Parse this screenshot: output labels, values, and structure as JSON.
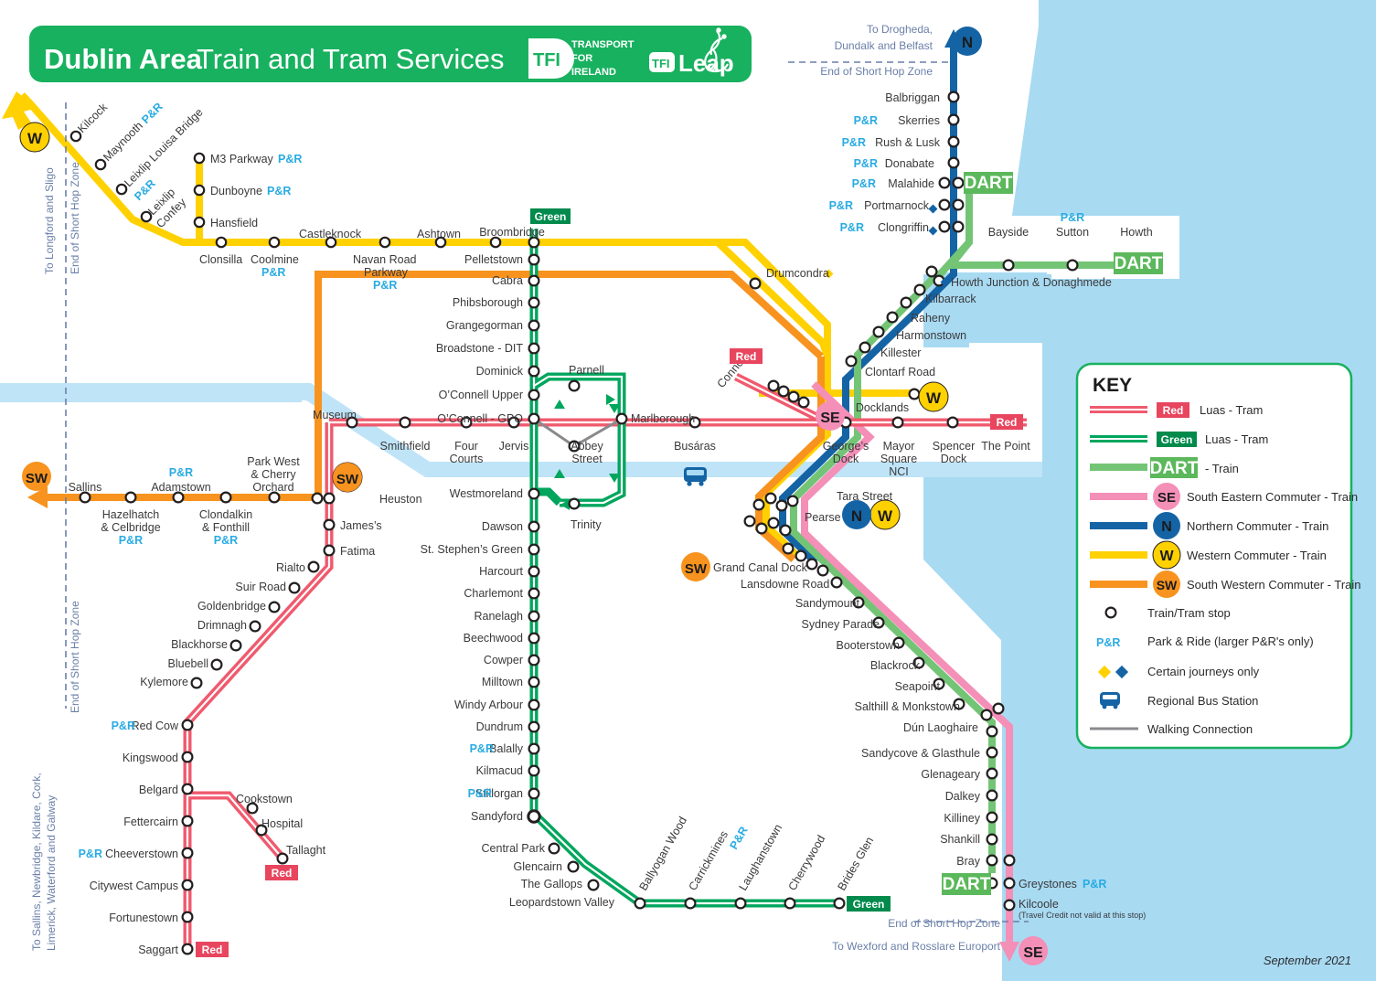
{
  "header": {
    "title_bold": "Dublin Area",
    "title_regular": " Train and Tram Services",
    "logo_tfi": "TFI",
    "logo_tfi_lines": [
      "TRANSPORT",
      "FOR",
      "IRELAND"
    ],
    "logo_leap_tfi": "TFI",
    "logo_leap": "Leap",
    "bg_color": "#18b15f"
  },
  "footer": {
    "date": "September 2021"
  },
  "colors": {
    "red_luas": "#f05a6e",
    "green_luas": "#00a65d",
    "dart": "#74c476",
    "south_eastern": "#f48fb7",
    "northern": "#1464a5",
    "western": "#ffd100",
    "south_western": "#f7931e",
    "water": "#a8daf2",
    "pr_blue": "#29abe2",
    "zone_blue": "#6a7fa8",
    "label": "#3a3a3c"
  },
  "key": {
    "title": "KEY",
    "rows": [
      {
        "badge": "Red",
        "badge_style": "red-pill",
        "label": "Luas - Tram",
        "line_color": "#f05a6e",
        "line_style": "tram"
      },
      {
        "badge": "Green",
        "badge_style": "green-pill",
        "label": "Luas - Tram",
        "line_color": "#00a65d",
        "line_style": "tram"
      },
      {
        "badge": "DART",
        "badge_style": "dart-pill",
        "label": "- Train",
        "line_color": "#74c476",
        "line_style": "solid"
      },
      {
        "badge": "SE",
        "badge_style": "circle-se",
        "label": "South Eastern Commuter - Train",
        "line_color": "#f48fb7",
        "line_style": "solid"
      },
      {
        "badge": "N",
        "badge_style": "circle-n",
        "label": "Northern Commuter - Train",
        "line_color": "#1464a5",
        "line_style": "solid"
      },
      {
        "badge": "W",
        "badge_style": "circle-w",
        "label": "Western Commuter - Train",
        "line_color": "#ffd100",
        "line_style": "solid"
      },
      {
        "badge": "SW",
        "badge_style": "circle-sw",
        "label": "South Western Commuter - Train",
        "line_color": "#f7931e",
        "line_style": "solid"
      }
    ],
    "symbols": [
      {
        "icon": "stop-circle-icon",
        "label": "Train/Tram stop"
      },
      {
        "icon": "park-and-ride-icon",
        "label": "Park & Ride (larger P&R's only)",
        "text": "P&R"
      },
      {
        "icon": "diamond-icon",
        "label": "Certain journeys only"
      },
      {
        "icon": "bus-station-icon",
        "label": "Regional Bus Station"
      },
      {
        "icon": "walking-line-icon",
        "label": "Walking Connection"
      }
    ]
  },
  "zone_notes": {
    "north_dest": "To Drogheda,\nDundalk and Belfast",
    "north_dest_l1": "To Drogheda,",
    "north_dest_l2": "Dundalk and Belfast",
    "north_zone": "End of Short Hop Zone",
    "northwest_dest": "To Longford and Sligo",
    "northwest_zone": "End of Short Hop Zone",
    "southwest_dest": "To Sallins, Newbridge, Kildare, Cork,",
    "southwest_dest2": "Limerick, Waterford and Galway",
    "southwest_zone": "End of Short Hop Zone",
    "southeast_zone": "End of Short Hop Zone",
    "southeast_dest": "To Wexford and Rosslare Europort",
    "kilcoole_note": "(Travel Credit not valid at this stop)"
  },
  "lines": {
    "western": {
      "name": "Western Commuter",
      "badge": "W",
      "stops_maynooth": [
        "Kilcock",
        "Maynooth",
        "Leixlip Louisa Bridge",
        "Leixlip Confey",
        "Clonsilla",
        "Coolmine",
        "Castleknock",
        "Navan Road Parkway",
        "Ashtown",
        "Broombridge",
        "Pelletstown"
      ],
      "stops_m3": [
        "M3 Parkway",
        "Dunboyne",
        "Hansfield"
      ],
      "stops_docklands": [
        "Docklands"
      ],
      "pr_stops": [
        "Maynooth",
        "Leixlip Louisa Bridge",
        "Coolmine",
        "Navan Road Parkway",
        "M3 Parkway",
        "Dunboyne"
      ]
    },
    "northern": {
      "name": "Northern Commuter",
      "badge": "N",
      "stops": [
        "Balbriggan",
        "Skerries",
        "Rush & Lusk",
        "Donabate",
        "Malahide",
        "Portmarnock",
        "Clongriffin",
        "Howth Junction & Donaghmede",
        "Kilbarrack",
        "Raheny",
        "Harmonstown",
        "Killester",
        "Clontarf Road",
        "Connolly",
        "Tara Street",
        "Pearse",
        "Drumcondra"
      ],
      "pr_stops": [
        "Skerries",
        "Rush & Lusk",
        "Donabate",
        "Malahide",
        "Portmarnock",
        "Clongriffin"
      ],
      "certain_journeys": [
        "Portmarnock",
        "Clongriffin",
        "Drumcondra",
        "Howth Junction & Donaghmede"
      ]
    },
    "dart": {
      "name": "DART",
      "badge": "DART",
      "stops_north": [
        "Malahide",
        "Portmarnock",
        "Clongriffin",
        "Howth Junction & Donaghmede",
        "Kilbarrack",
        "Raheny",
        "Harmonstown",
        "Killester",
        "Clontarf Road",
        "Connolly"
      ],
      "stops_howth_branch": [
        "Bayside",
        "Sutton",
        "Howth"
      ],
      "stops_south": [
        "Tara Street",
        "Pearse",
        "Grand Canal Dock",
        "Lansdowne Road",
        "Sandymount",
        "Sydney Parade",
        "Booterstown",
        "Blackrock",
        "Seapoint",
        "Salthill & Monkstown",
        "Dún Laoghaire",
        "Sandycove & Glasthule",
        "Glenageary",
        "Dalkey",
        "Killiney",
        "Shankill",
        "Bray",
        "Greystones"
      ],
      "pr_stops": [
        "Sutton",
        "Greystones"
      ]
    },
    "south_eastern": {
      "name": "South Eastern Commuter",
      "badge": "SE",
      "stops": [
        "Connolly",
        "Tara Street",
        "Pearse",
        "Grand Canal Dock",
        "Lansdowne Road",
        "Sandymount",
        "Sydney Parade",
        "Booterstown",
        "Blackrock",
        "Seapoint",
        "Salthill & Monkstown",
        "Dún Laoghaire",
        "Sandycove & Glasthule",
        "Glenageary",
        "Dalkey",
        "Killiney",
        "Shankill",
        "Bray",
        "Greystones",
        "Kilcoole"
      ]
    },
    "south_western": {
      "name": "South Western Commuter",
      "badge": "SW",
      "stops": [
        "Sallins",
        "Hazelhatch & Celbridge",
        "Adamstown",
        "Clondalkin & Fonthill",
        "Park West & Cherry Orchard",
        "Heuston",
        "Grand Canal Dock"
      ],
      "pr_stops": [
        "Hazelhatch & Celbridge",
        "Adamstown",
        "Clondalkin & Fonthill"
      ]
    },
    "red_luas": {
      "name": "Red Luas",
      "badge": "Red",
      "stops_main": [
        "Museum",
        "Smithfield",
        "Four Courts",
        "Jervis",
        "Abbey Street",
        "Busáras",
        "George's Dock",
        "Mayor Square NCI",
        "Spencer Dock",
        "The Point"
      ],
      "stops_west": [
        "Heuston",
        "James's",
        "Fatima",
        "Rialto",
        "Suir Road",
        "Goldenbridge",
        "Drimnagh",
        "Blackhorse",
        "Bluebell",
        "Kylemore",
        "Red Cow",
        "Kingswood",
        "Belgard",
        "Fettercairn",
        "Cheeverstown",
        "Citywest Campus",
        "Fortunestown",
        "Saggart"
      ],
      "stops_tallaght_branch": [
        "Cookstown",
        "Hospital",
        "Tallaght"
      ],
      "pr_stops": [
        "Red Cow",
        "Cheeverstown"
      ],
      "termini": [
        "Saggart",
        "Tallaght",
        "The Point"
      ]
    },
    "green_luas": {
      "name": "Green Luas",
      "badge": "Green",
      "stops": [
        "Broombridge",
        "Cabra",
        "Phibsborough",
        "Grangegorman",
        "Broadstone - DIT",
        "Dominick",
        "Parnell",
        "O'Connell Upper",
        "O'Connell - GPO",
        "Marlborough",
        "Abbey Street",
        "Westmoreland",
        "Trinity",
        "Dawson",
        "St. Stephen's Green",
        "Harcourt",
        "Charlemont",
        "Ranelagh",
        "Beechwood",
        "Cowper",
        "Milltown",
        "Windy Arbour",
        "Dundrum",
        "Balally",
        "Kilmacud",
        "Stillorgan",
        "Sandyford",
        "Central Park",
        "Glencairn",
        "The Gallops",
        "Leopardstown Valley",
        "Ballyogan Wood",
        "Carrickmines",
        "Laughanstown",
        "Cherrywood",
        "Brides Glen"
      ],
      "pr_stops": [
        "Balally",
        "Stillorgan",
        "Carrickmines"
      ],
      "termini": [
        "Broombridge",
        "Brides Glen"
      ]
    }
  },
  "labels": {
    "kilcock": "Kilcock",
    "maynooth": "Maynooth",
    "leixlip_louisa": "Leixlip Louisa Bridge",
    "leixlip_confey": "Leixlip Confey",
    "m3_parkway": "M3 Parkway",
    "dunboyne": "Dunboyne",
    "hansfield": "Hansfield",
    "clonsilla": "Clonsilla",
    "coolmine": "Coolmine",
    "castleknock": "Castleknock",
    "navan_road": "Navan Road",
    "parkway": "Parkway",
    "ashtown": "Ashtown",
    "broombridge": "Broombridge",
    "pelletstown": "Pelletstown",
    "cabra": "Cabra",
    "phibsborough": "Phibsborough",
    "grangegorman": "Grangegorman",
    "broadstone": "Broadstone - DIT",
    "dominick": "Dominick",
    "parnell": "Parnell",
    "oconnell_upper": "O’Connell Upper",
    "oconnell_gpo": "O’Connell - GPO",
    "marlborough": "Marlborough",
    "museum": "Museum",
    "smithfield": "Smithfield",
    "four_courts_1": "Four",
    "four_courts_2": "Courts",
    "jervis": "Jervis",
    "abbey_1": "Abbey",
    "abbey_2": "Street",
    "busaras": "Busáras",
    "westmoreland": "Westmoreland",
    "trinity": "Trinity",
    "dawson": "Dawson",
    "stephens_green": "St. Stephen’s Green",
    "harcourt": "Harcourt",
    "charlemont": "Charlemont",
    "ranelagh": "Ranelagh",
    "beechwood": "Beechwood",
    "cowper": "Cowper",
    "milltown": "Milltown",
    "windy_arbour": "Windy Arbour",
    "dundrum": "Dundrum",
    "balally": "Balally",
    "kilmacud": "Kilmacud",
    "stillorgan": "Stillorgan",
    "sandyford": "Sandyford",
    "central_park": "Central Park",
    "glencairn": "Glencairn",
    "the_gallops": "The Gallops",
    "leopardstown_valley": "Leopardstown Valley",
    "ballyogan_wood": "Ballyogan Wood",
    "carrickmines": "Carrickmines",
    "laughanstown": "Laughanstown",
    "cherrywood": "Cherrywood",
    "brides_glen": "Brides Glen",
    "sallins": "Sallins",
    "hazelhatch_1": "Hazelhatch",
    "hazelhatch_2": "& Celbridge",
    "adamstown": "Adamstown",
    "clondalkin_1": "Clondalkin",
    "clondalkin_2": "& Fonthill",
    "parkwest_1": "Park West",
    "parkwest_2": "& Cherry",
    "parkwest_3": "Orchard",
    "heuston": "Heuston",
    "jamess": "James’s",
    "fatima": "Fatima",
    "rialto": "Rialto",
    "suir_road": "Suir Road",
    "goldenbridge": "Goldenbridge",
    "drimnagh": "Drimnagh",
    "blackhorse": "Blackhorse",
    "bluebell": "Bluebell",
    "kylemore": "Kylemore",
    "red_cow": "Red Cow",
    "kingswood": "Kingswood",
    "belgard": "Belgard",
    "fettercairn": "Fettercairn",
    "cheeverstown": "Cheeverstown",
    "citywest": "Citywest Campus",
    "fortunestown": "Fortunestown",
    "saggart": "Saggart",
    "cookstown": "Cookstown",
    "hospital": "Hospital",
    "tallaght": "Tallaght",
    "balbriggan": "Balbriggan",
    "skerries": "Skerries",
    "rush_lusk": "Rush & Lusk",
    "donabate": "Donabate",
    "malahide": "Malahide",
    "portmarnock": "Portmarnock",
    "clongriffin": "Clongriffin",
    "bayside": "Bayside",
    "sutton": "Sutton",
    "howth": "Howth",
    "howth_junction": "Howth Junction & Donaghmede",
    "kilbarrack": "Kilbarrack",
    "raheny": "Raheny",
    "harmonstown": "Harmonstown",
    "killester": "Killester",
    "clontarf_road": "Clontarf Road",
    "drumcondra": "Drumcondra",
    "connolly": "Connolly",
    "docklands": "Docklands",
    "georges_1": "George’s",
    "georges_2": "Dock",
    "mayor_1": "Mayor",
    "mayor_2": "Square",
    "mayor_3": "NCI",
    "spencer_1": "Spencer",
    "spencer_2": "Dock",
    "the_point": "The Point",
    "tara_street": "Tara Street",
    "pearse": "Pearse",
    "grand_canal_dock": "Grand Canal Dock",
    "lansdowne": "Lansdowne Road",
    "sandymount": "Sandymount",
    "sydney_parade": "Sydney Parade",
    "booterstown": "Booterstown",
    "blackrock": "Blackrock",
    "seapoint": "Seapoint",
    "salthill": "Salthill & Monkstown",
    "dun_laoghaire": "Dún Laoghaire",
    "sandycove": "Sandycove & Glasthule",
    "glenageary": "Glenageary",
    "dalkey": "Dalkey",
    "killiney": "Killiney",
    "shankill": "Shankill",
    "bray": "Bray",
    "greystones": "Greystones",
    "kilcoole": "Kilcoole",
    "pr": "P&R"
  },
  "badges": {
    "red": "Red",
    "green": "Green",
    "dart": "DART",
    "w": "W",
    "n": "N",
    "se": "SE",
    "sw": "SW"
  }
}
